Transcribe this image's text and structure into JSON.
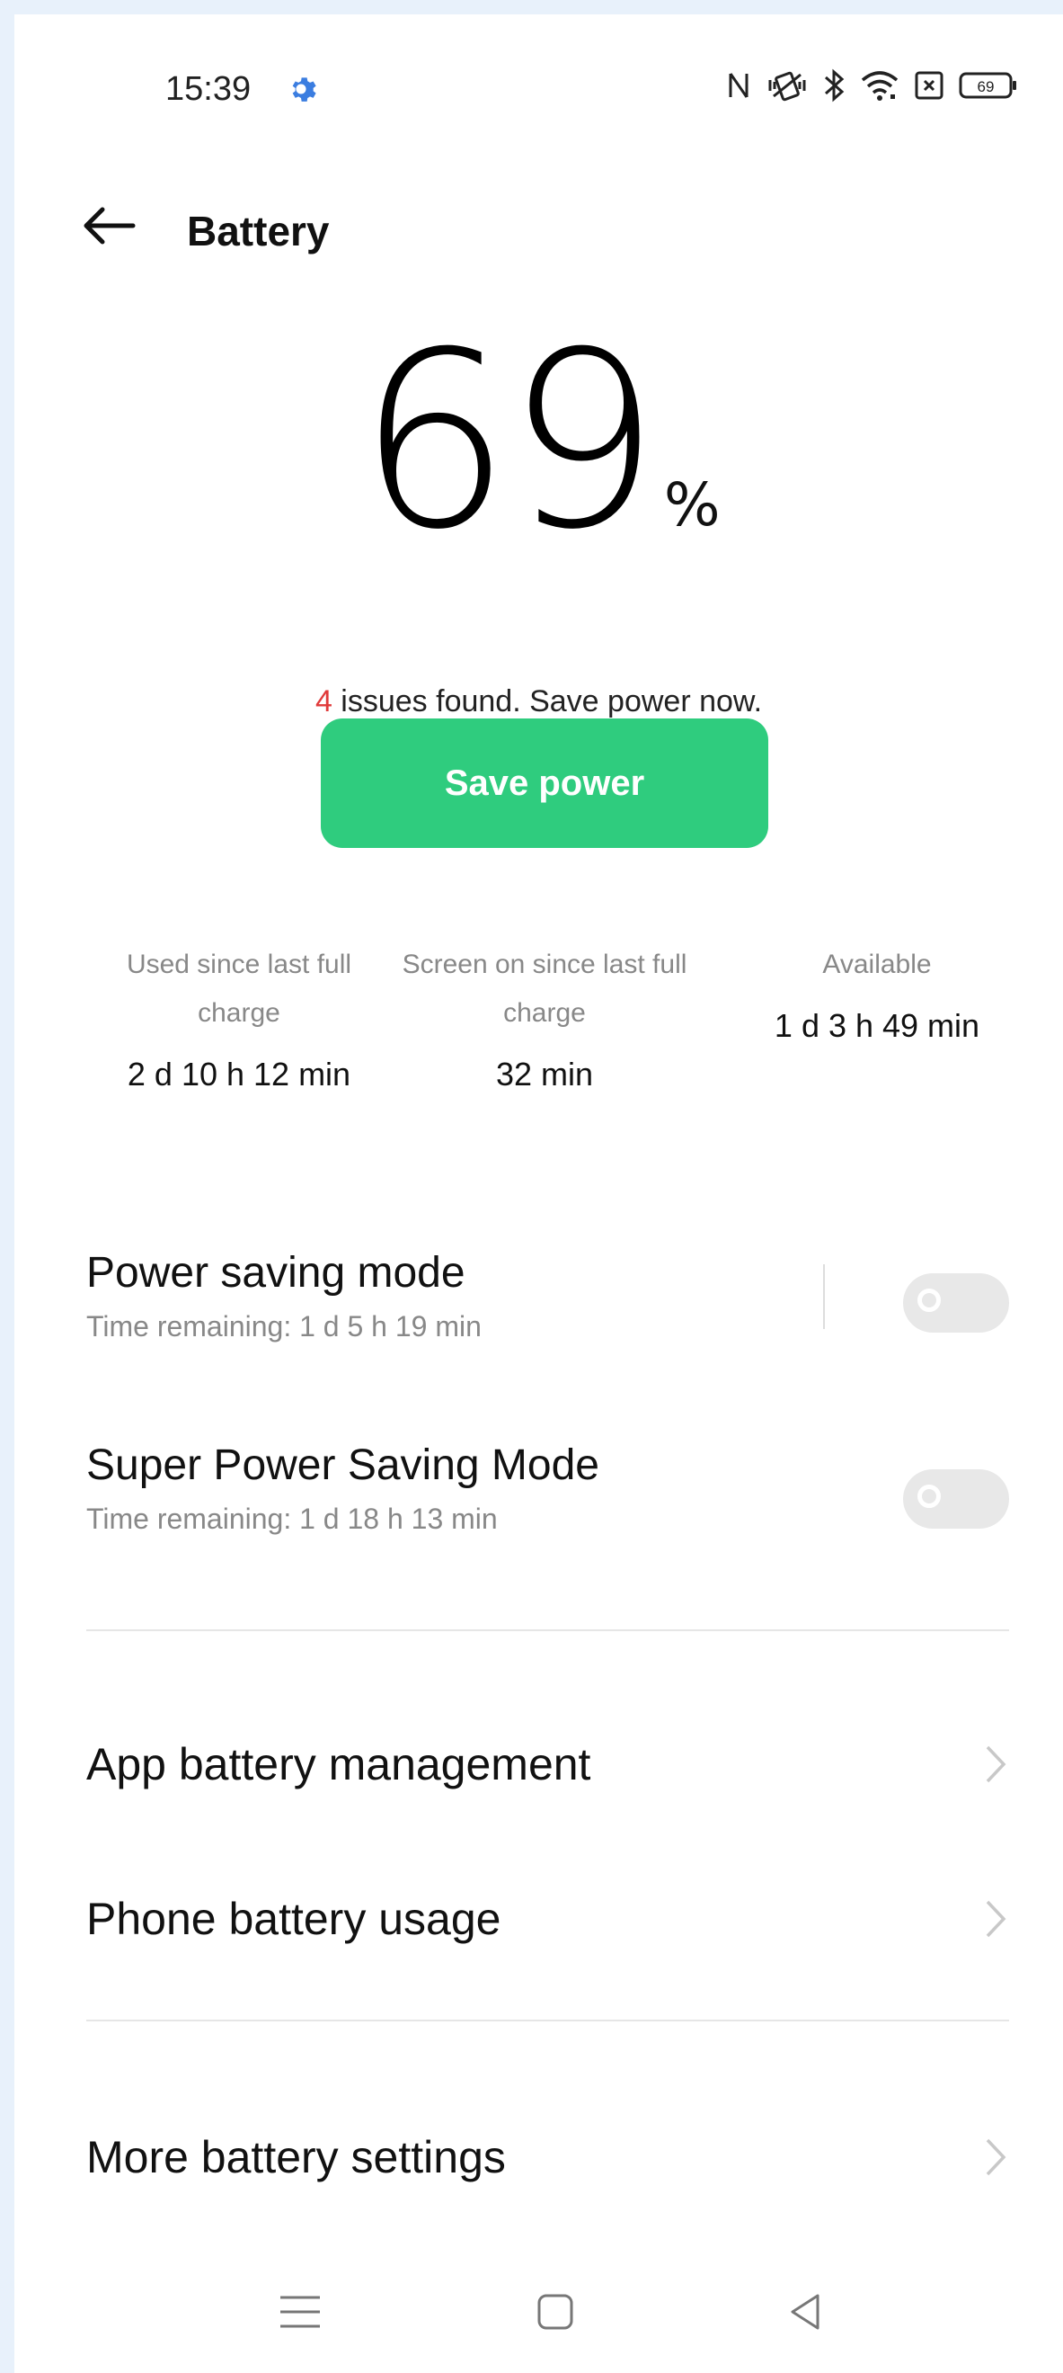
{
  "status_bar": {
    "time": "15:39",
    "battery_level": "69",
    "icons": [
      "settings-gear-icon",
      "nfc-icon",
      "vibrate-icon",
      "bluetooth-icon",
      "wifi-icon",
      "close-box-icon",
      "battery-icon"
    ]
  },
  "header": {
    "title": "Battery"
  },
  "battery": {
    "percent": "69",
    "percent_sign": "%",
    "issue_count": "4",
    "issues_text": " issues found. Save power now.",
    "save_button_label": "Save power"
  },
  "stats": [
    {
      "label": "Used since last full charge",
      "value": "2 d 10 h 12 min"
    },
    {
      "label": "Screen on since last full charge",
      "value": "32 min"
    },
    {
      "label": "Available",
      "value": "1 d 3 h 49 min"
    }
  ],
  "modes": [
    {
      "title": "Power saving mode",
      "subtitle": "Time remaining:  1 d 5 h 19 min",
      "enabled": false
    },
    {
      "title": "Super Power Saving Mode",
      "subtitle": "Time remaining:  1 d 18 h 13 min",
      "enabled": false
    }
  ],
  "menu": {
    "app_battery_management": "App battery management",
    "phone_battery_usage": "Phone battery usage",
    "more_battery_settings": "More battery settings"
  },
  "colors": {
    "accent_green": "#2fcc7e",
    "issue_red": "#e03a3a",
    "gear_blue": "#3b7de0"
  }
}
